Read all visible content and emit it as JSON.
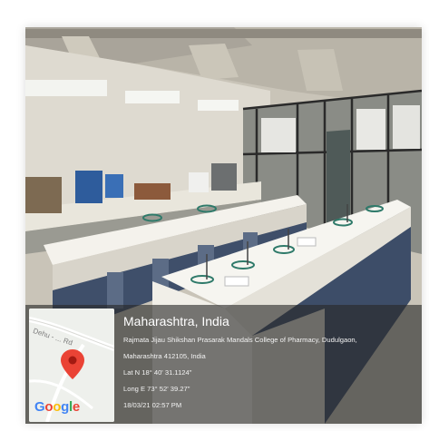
{
  "geo_overlay": {
    "place": "Maharashtra, India",
    "address_line1": "Rajmata Jijau Shikshan Prasarak Mandals College of Pharmacy, Dudulgaon,",
    "address_line2": "Maharashtra 412105, India",
    "latitude": "Lat N 18° 40' 31.1124\"",
    "longitude": "Long E 73° 52' 39.27\"",
    "timestamp": "18/03/21 02:57 PM"
  },
  "map_thumb": {
    "road_label": "Dehu - ... Rd",
    "logo_letters": [
      "G",
      "o",
      "o",
      "g",
      "l",
      "e"
    ],
    "logo_colors": [
      "#4285F4",
      "#EA4335",
      "#FBBC05",
      "#4285F4",
      "#34A853",
      "#EA4335"
    ],
    "pin_color": "#EA4335"
  },
  "photo": {
    "subject": "pharmacy laboratory with benches"
  }
}
